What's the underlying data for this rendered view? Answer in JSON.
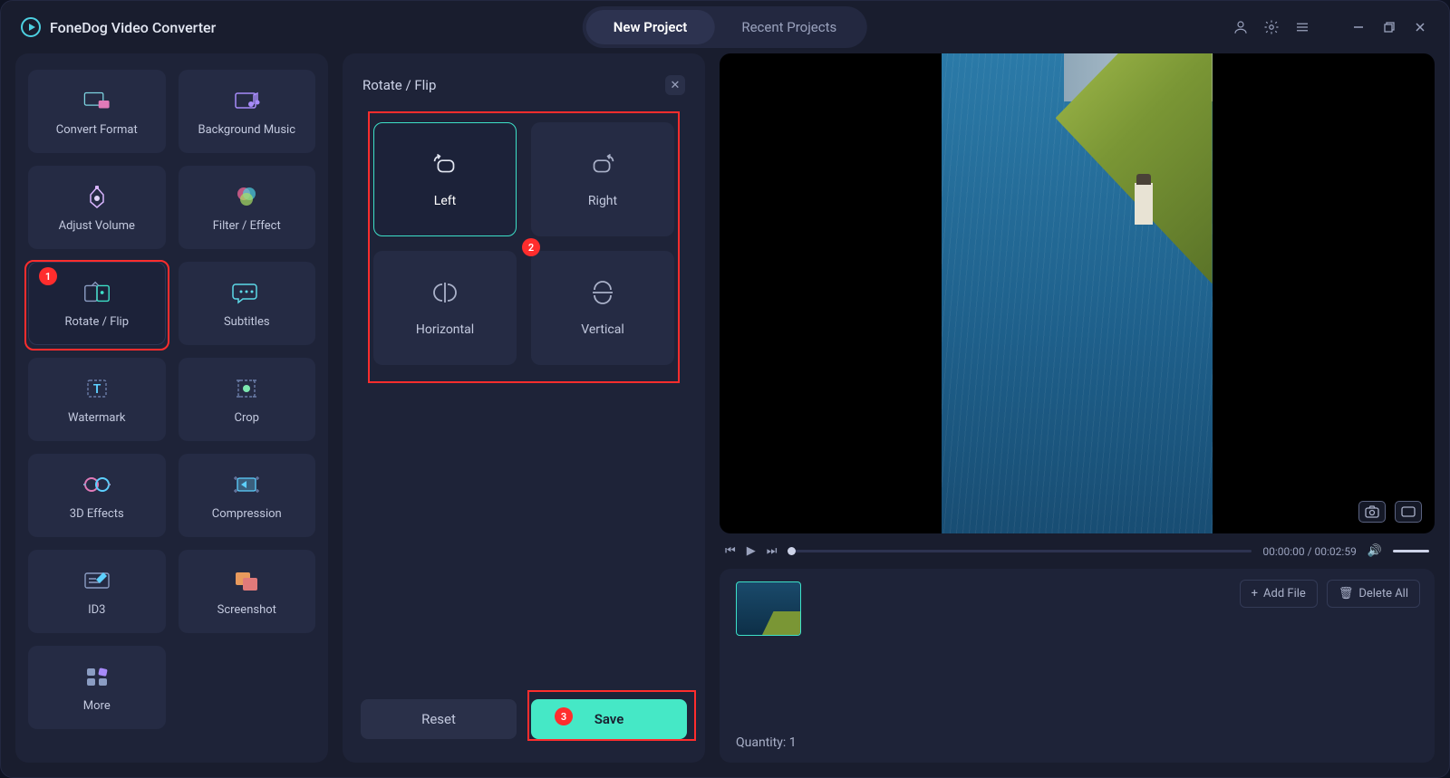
{
  "app": {
    "title": "FoneDog Video Converter"
  },
  "tabs": {
    "new_project": "New Project",
    "recent_projects": "Recent Projects"
  },
  "tools": {
    "convert_format": "Convert Format",
    "background_music": "Background Music",
    "adjust_volume": "Adjust Volume",
    "filter_effect": "Filter / Effect",
    "rotate_flip": "Rotate / Flip",
    "subtitles": "Subtitles",
    "watermark": "Watermark",
    "crop": "Crop",
    "three_d_effects": "3D Effects",
    "compression": "Compression",
    "id3": "ID3",
    "screenshot": "Screenshot",
    "more": "More"
  },
  "options": {
    "title": "Rotate / Flip",
    "left": "Left",
    "right": "Right",
    "horizontal": "Horizontal",
    "vertical": "Vertical",
    "reset": "Reset",
    "save": "Save"
  },
  "preview": {
    "time_current": "00:00:00",
    "time_total": "00:02:59"
  },
  "filelist": {
    "add_file": "Add File",
    "delete_all": "Delete All",
    "quantity_label": "Quantity:",
    "quantity_value": "1"
  },
  "annotations": {
    "badge1": "1",
    "badge2": "2",
    "badge3": "3"
  }
}
